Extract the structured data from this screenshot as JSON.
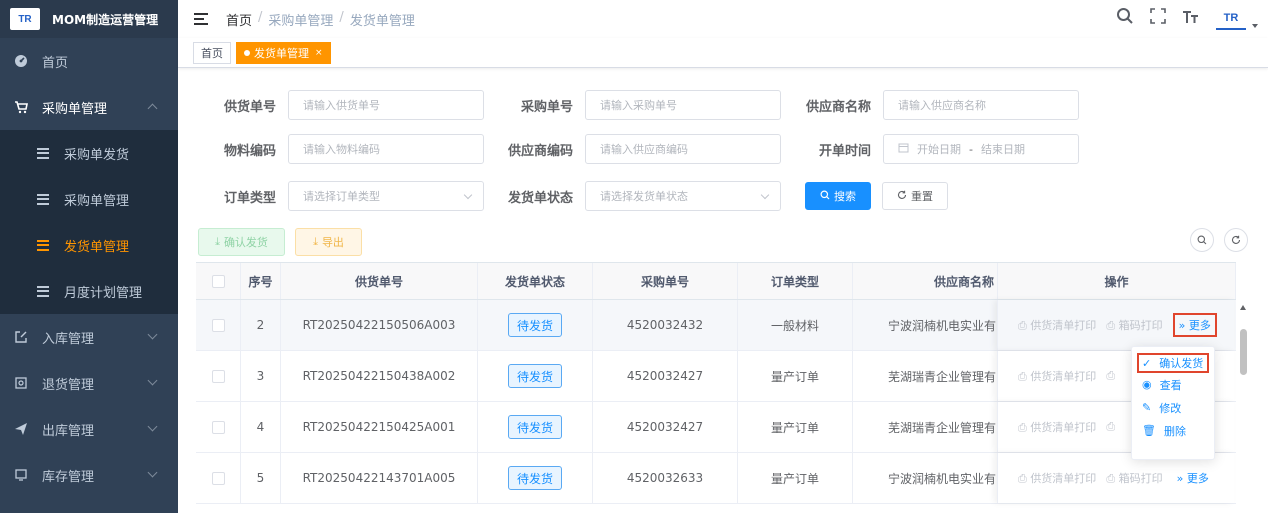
{
  "app": {
    "title": "MOM制造运营管理",
    "logo_text": "TR"
  },
  "sidebar": {
    "items": [
      {
        "label": "首页",
        "icon": "dashboard-icon"
      },
      {
        "label": "采购单管理",
        "icon": "cart-icon",
        "expanded": true
      },
      {
        "label": "采购单发货",
        "icon": "list-icon"
      },
      {
        "label": "采购单管理",
        "icon": "list-icon"
      },
      {
        "label": "发货单管理",
        "icon": "list-icon",
        "active": true
      },
      {
        "label": "月度计划管理",
        "icon": "list-icon"
      },
      {
        "label": "入库管理",
        "icon": "edit-icon"
      },
      {
        "label": "退货管理",
        "icon": "return-icon"
      },
      {
        "label": "出库管理",
        "icon": "send-icon"
      },
      {
        "label": "库存管理",
        "icon": "inventory-icon"
      }
    ]
  },
  "navbar": {
    "breadcrumb": [
      "首页",
      "采购单管理",
      "发货单管理"
    ],
    "separator": "/"
  },
  "tags": [
    {
      "label": "首页"
    },
    {
      "label": "发货单管理",
      "close": "×"
    }
  ],
  "search_form": {
    "supply_no": {
      "label": "供货单号",
      "placeholder": "请输入供货单号"
    },
    "purchase_no": {
      "label": "采购单号",
      "placeholder": "请输入采购单号"
    },
    "supplier_name": {
      "label": "供应商名称",
      "placeholder": "请输入供应商名称"
    },
    "material_code": {
      "label": "物料编码",
      "placeholder": "请输入物料编码"
    },
    "supplier_code": {
      "label": "供应商编码",
      "placeholder": "请输入供应商编码"
    },
    "open_time": {
      "label": "开单时间",
      "start": "开始日期",
      "sep": "-",
      "end": "结束日期"
    },
    "order_type": {
      "label": "订单类型",
      "placeholder": "请选择订单类型"
    },
    "status": {
      "label": "发货单状态",
      "placeholder": "请选择发货单状态"
    },
    "search_button": "搜索",
    "reset_button": "重置"
  },
  "toolbar": {
    "confirm_label": "确认发货",
    "export_label": "导出"
  },
  "table": {
    "columns": [
      "序号",
      "供货单号",
      "发货单状态",
      "采购单号",
      "订单类型",
      "供应商名称",
      "操作"
    ],
    "rows": [
      {
        "index": "2",
        "supply_no": "RT20250422150506A003",
        "status": "待发货",
        "purchase_no": "4520032432",
        "order_type": "一般材料",
        "supplier": "宁波润楠机电实业有"
      },
      {
        "index": "3",
        "supply_no": "RT20250422150438A002",
        "status": "待发货",
        "purchase_no": "4520032427",
        "order_type": "量产订单",
        "supplier": "芜湖瑞青企业管理有"
      },
      {
        "index": "4",
        "supply_no": "RT20250422150425A001",
        "status": "待发货",
        "purchase_no": "4520032427",
        "order_type": "量产订单",
        "supplier": "芜湖瑞青企业管理有"
      },
      {
        "index": "5",
        "supply_no": "RT20250422143701A005",
        "status": "待发货",
        "purchase_no": "4520032633",
        "order_type": "量产订单",
        "supplier": "宁波润楠机电实业有"
      }
    ],
    "ops": {
      "print_list": "供货清单打印",
      "print_box": "箱码打印",
      "more": "更多"
    }
  },
  "more_menu": {
    "items": [
      {
        "label": "确认发货",
        "icon": "check-icon"
      },
      {
        "label": "查看",
        "icon": "eye-icon"
      },
      {
        "label": "修改",
        "icon": "edit-icon"
      },
      {
        "label": "删除",
        "icon": "delete-icon"
      }
    ]
  },
  "colors": {
    "accent": "#ff9500",
    "primary": "#1890ff",
    "sidebar": "#304156",
    "highlight_border": "#e0452d"
  }
}
